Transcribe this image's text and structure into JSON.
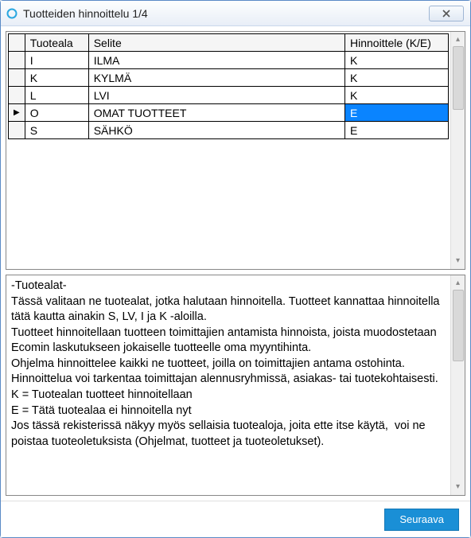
{
  "window": {
    "title": "Tuotteiden hinnoittelu 1/4"
  },
  "table": {
    "headers": {
      "area": "Tuoteala",
      "desc": "Selite",
      "price": "Hinnoittele (K/E)"
    },
    "rows": [
      {
        "marker": "",
        "area": "I",
        "desc": "ILMA",
        "price": "K",
        "selected": false
      },
      {
        "marker": "",
        "area": "K",
        "desc": "KYLMÄ",
        "price": "K",
        "selected": false
      },
      {
        "marker": "",
        "area": "L",
        "desc": "LVI",
        "price": "K",
        "selected": false
      },
      {
        "marker": "▶",
        "area": "O",
        "desc": "OMAT TUOTTEET",
        "price": "E",
        "selected": true
      },
      {
        "marker": "",
        "area": "S",
        "desc": "SÄHKÖ",
        "price": "E",
        "selected": false
      }
    ]
  },
  "info": {
    "text": "-Tuotealat-\nTässä valitaan ne tuotealat, jotka halutaan hinnoitella. Tuotteet kannattaa hinnoitella tätä kautta ainakin S, LV, I ja K -aloilla.\nTuotteet hinnoitellaan tuotteen toimittajien antamista hinnoista, joista muodostetaan Ecomin laskutukseen jokaiselle tuotteelle oma myyntihinta.\nOhjelma hinnoittelee kaikki ne tuotteet, joilla on toimittajien antama ostohinta. Hinnoittelua voi tarkentaa toimittajan alennusryhmissä, asiakas- tai tuotekohtaisesti.\nK = Tuotealan tuotteet hinnoitellaan\nE = Tätä tuotealaa ei hinnoitella nyt\nJos tässä rekisterissä näkyy myös sellaisia tuotealoja, joita ette itse käytä,  voi ne poistaa tuoteoletuksista (Ohjelmat, tuotteet ja tuoteoletukset)."
  },
  "footer": {
    "next_label": "Seuraava"
  }
}
